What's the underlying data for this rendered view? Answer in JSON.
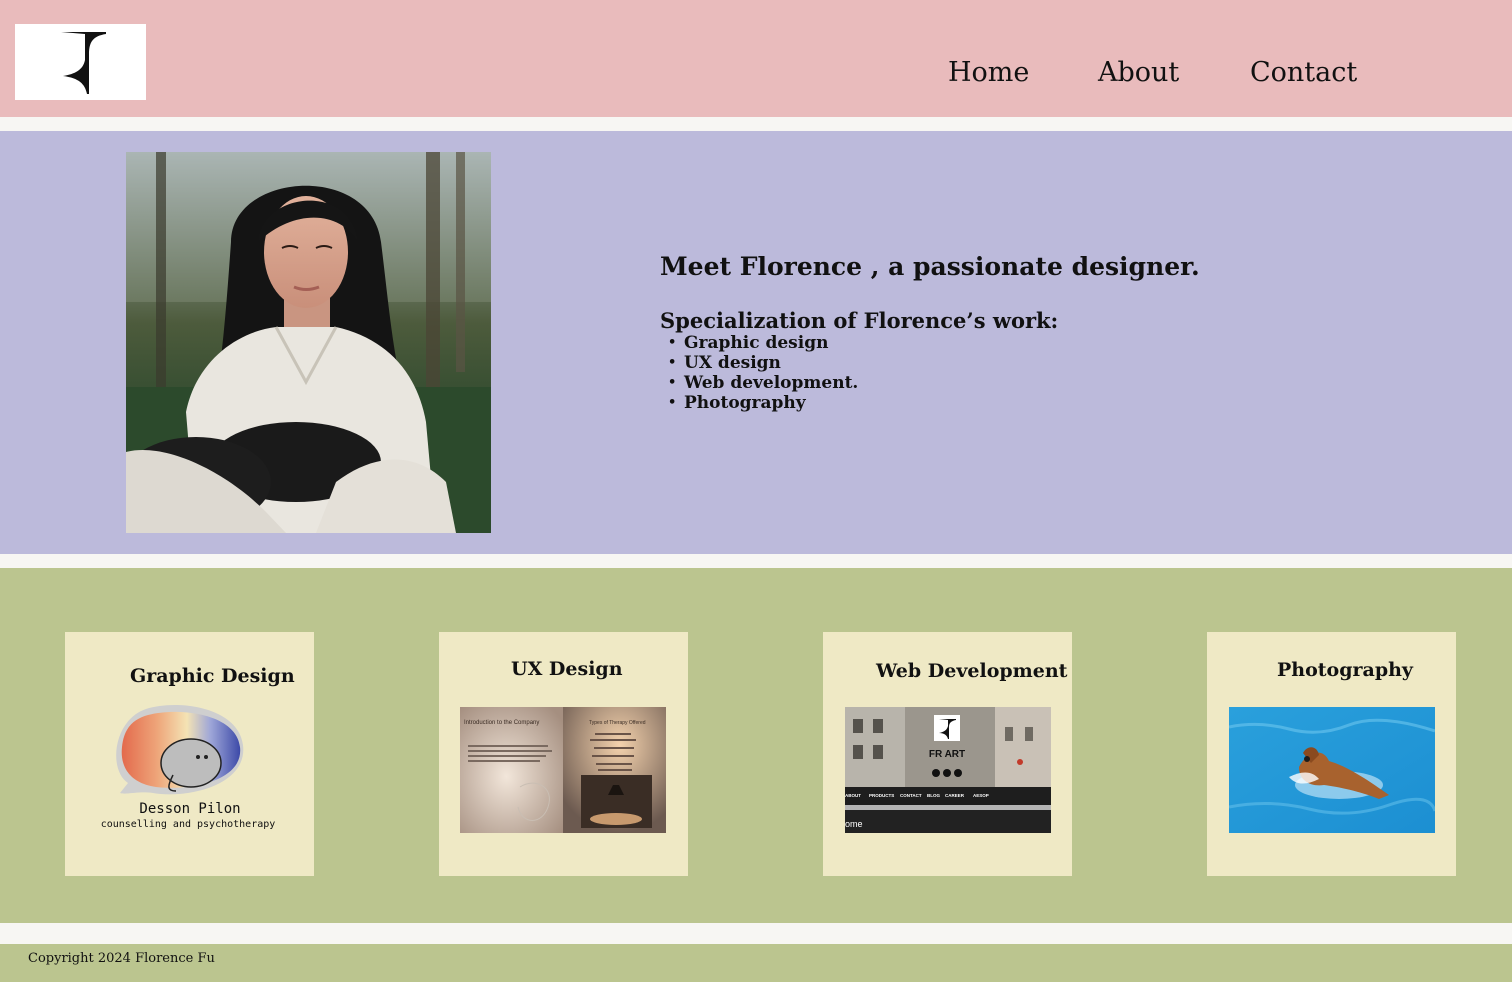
{
  "nav": {
    "home_label": "Home",
    "about_label": "About",
    "contact_label": "Contact"
  },
  "hero": {
    "headline": "Meet Florence , a passionate designer.",
    "spec_title": "Specialization of Florence’s work:",
    "spec_items": [
      "Graphic design",
      "UX design",
      "Web development.",
      "Photography"
    ]
  },
  "cards": [
    {
      "title": "Graphic Design",
      "thumb": {
        "logo_name": "Desson Pilon",
        "logo_tagline": "counselling and psychotherapy"
      }
    },
    {
      "title": "UX Design",
      "thumb": {
        "slide1_title": "Introduction to the Company",
        "slide2_title": "Types of Therapy Offered"
      }
    },
    {
      "title": "Web Development",
      "thumb": {
        "brand": "FR ART",
        "menu": [
          "ABOUT",
          "PRODUCTS",
          "CONTACT",
          "BLOG",
          "CAREER",
          "AESOP"
        ],
        "fragment": "ome"
      }
    },
    {
      "title": "Photography",
      "thumb": {}
    }
  ],
  "footer": {
    "copyright": "Copyright 2024 Florence Fu"
  },
  "colors": {
    "header_bg": "#e9bbbc",
    "hero_bg": "#bcbadb",
    "work_bg": "#bbc58f",
    "card_bg": "#efe9c5"
  }
}
